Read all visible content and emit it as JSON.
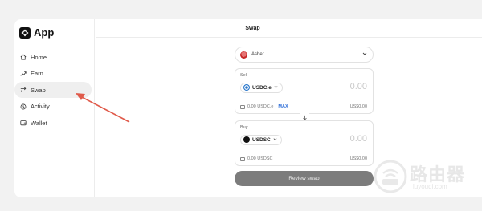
{
  "app": {
    "logo_text": "App"
  },
  "sidebar": {
    "items": [
      {
        "label": "Home",
        "icon": "home-icon"
      },
      {
        "label": "Earn",
        "icon": "earn-icon"
      },
      {
        "label": "Swap",
        "icon": "swap-icon",
        "active": true
      },
      {
        "label": "Activity",
        "icon": "activity-icon"
      },
      {
        "label": "Wallet",
        "icon": "wallet-icon"
      }
    ]
  },
  "header": {
    "title": "Swap"
  },
  "account": {
    "name": "Asher"
  },
  "sell": {
    "label": "Sell",
    "token": "USDC.e",
    "amount": "0.00",
    "balance": "0.00 USDC.e",
    "max_label": "MAX",
    "usd_value": "US$0.00"
  },
  "buy": {
    "label": "Buy",
    "token": "USDSC",
    "amount": "0.00",
    "balance": "0.00 USDSC",
    "usd_value": "US$0.00"
  },
  "review_button": "Review swap",
  "watermark": {
    "text": "路由器",
    "sub": "luyouqi.com"
  },
  "colors": {
    "accent": "#2f6fd8",
    "annotation": "#e05a4a",
    "button": "#7c7c7c"
  }
}
